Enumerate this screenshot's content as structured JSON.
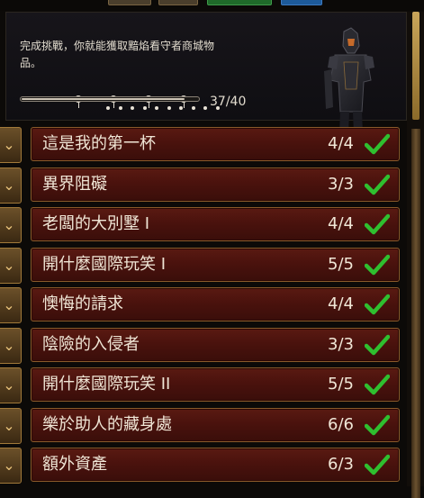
{
  "header": {
    "description": "完成挑戰，你就能獲取黯焰看守者商城物品。",
    "progress": {
      "current": 37,
      "total": 40,
      "label": "37/40"
    },
    "figure": "armored-warden-figure"
  },
  "colors": {
    "check": "#2fbf2f",
    "row_bg": "#4a120d",
    "frame": "#8a5a2a"
  },
  "challenges": [
    {
      "title": "這是我的第一杯",
      "count": "4/4"
    },
    {
      "title": "異界阻礙",
      "count": "3/3"
    },
    {
      "title": "老闆的大別墅 I",
      "count": "4/4"
    },
    {
      "title": "開什麼國際玩笑 I",
      "count": "5/5"
    },
    {
      "title": "懊悔的請求",
      "count": "4/4"
    },
    {
      "title": "陰險的入侵者",
      "count": "3/3"
    },
    {
      "title": "開什麼國際玩笑 II",
      "count": "5/5"
    },
    {
      "title": "樂於助人的藏身處",
      "count": "6/6"
    },
    {
      "title": "額外資產",
      "count": "6/3"
    }
  ]
}
